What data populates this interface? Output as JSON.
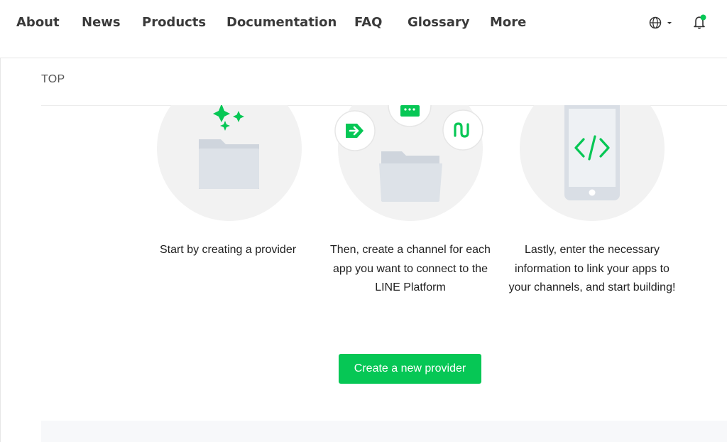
{
  "nav": {
    "items": [
      "About",
      "News",
      "Products",
      "Documentation",
      "FAQ",
      "Glossary",
      "More"
    ]
  },
  "header_icons": {
    "language": "globe-icon",
    "notifications": "bell-icon",
    "notification_dot_color": "#06c755"
  },
  "breadcrumb": {
    "label": "TOP"
  },
  "steps": [
    {
      "icon": "folder-sparkle-illustration",
      "text": "Start by creating a provider"
    },
    {
      "icon": "folder-channels-illustration",
      "text": "Then, create a channel for each app you want to connect to the LINE Platform"
    },
    {
      "icon": "phone-code-illustration",
      "text": "Lastly, enter the necessary information to link your apps to your channels, and start building!"
    }
  ],
  "cta": {
    "label": "Create a new provider"
  },
  "colors": {
    "accent": "#06c755",
    "circle": "#f2f2f2",
    "folder": "#d9dee5"
  }
}
